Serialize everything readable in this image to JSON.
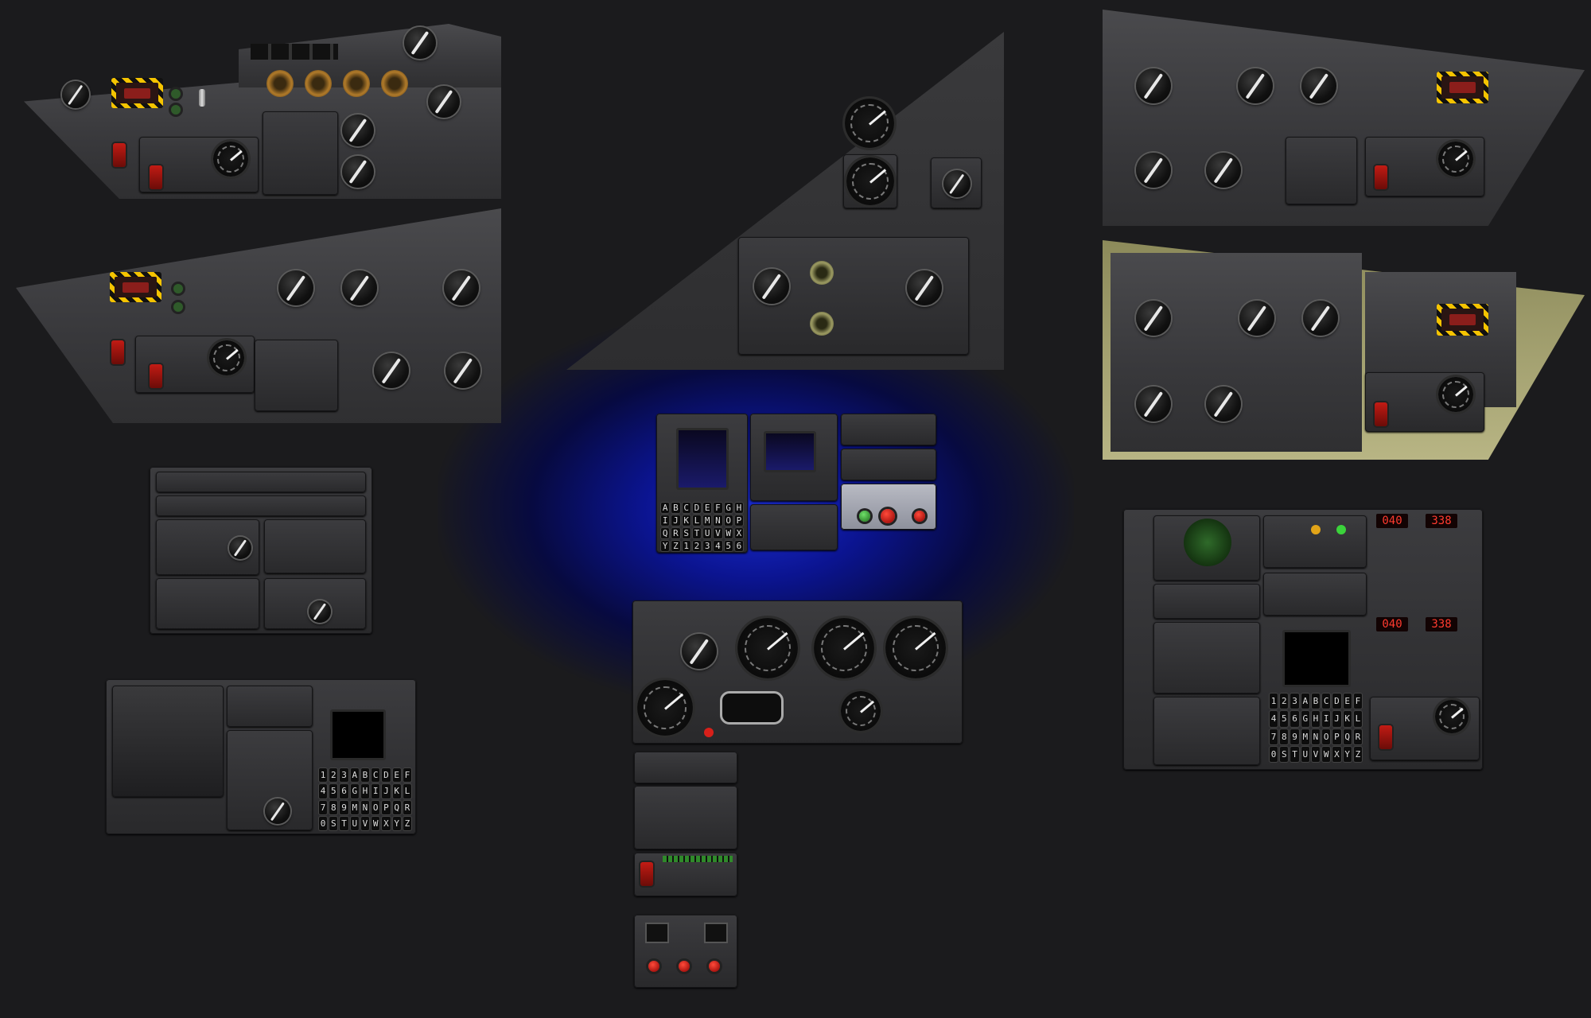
{
  "colors": {
    "background": "#1b1b1d",
    "center_glow": "#1a2bd0",
    "hazard_yellow": "#f5c400",
    "panel_olive": "#8c8a5a",
    "segment_red": "#ff3b2f"
  },
  "keypads": {
    "center_cdu": [
      "A",
      "B",
      "C",
      "D",
      "E",
      "F",
      "G",
      "H",
      "I",
      "J",
      "K",
      "L",
      "M",
      "N",
      "O",
      "P",
      "Q",
      "R",
      "S",
      "T",
      "U",
      "V",
      "W",
      "X",
      "Y",
      "Z",
      "1",
      "2",
      "3",
      "4",
      "5",
      "6"
    ],
    "left_bottom_cdu": [
      "1",
      "2",
      "3",
      "A",
      "B",
      "C",
      "D",
      "E",
      "F",
      "4",
      "5",
      "6",
      "G",
      "H",
      "I",
      "J",
      "K",
      "L",
      "7",
      "8",
      "9",
      "M",
      "N",
      "O",
      "P",
      "Q",
      "R",
      "0",
      "S",
      "T",
      "U",
      "V",
      "W",
      "X",
      "Y",
      "Z"
    ],
    "right_cdu": [
      "1",
      "2",
      "3",
      "A",
      "B",
      "C",
      "D",
      "E",
      "F",
      "4",
      "5",
      "6",
      "G",
      "H",
      "I",
      "J",
      "K",
      "L",
      "7",
      "8",
      "9",
      "M",
      "N",
      "O",
      "P",
      "Q",
      "R",
      "0",
      "S",
      "T",
      "U",
      "V",
      "W",
      "X",
      "Y",
      "Z"
    ]
  },
  "displays": {
    "right_seg_top_left": "040",
    "right_seg_top_right": "338",
    "right_seg_bottom_left": "040",
    "right_seg_bottom_right": "338"
  }
}
